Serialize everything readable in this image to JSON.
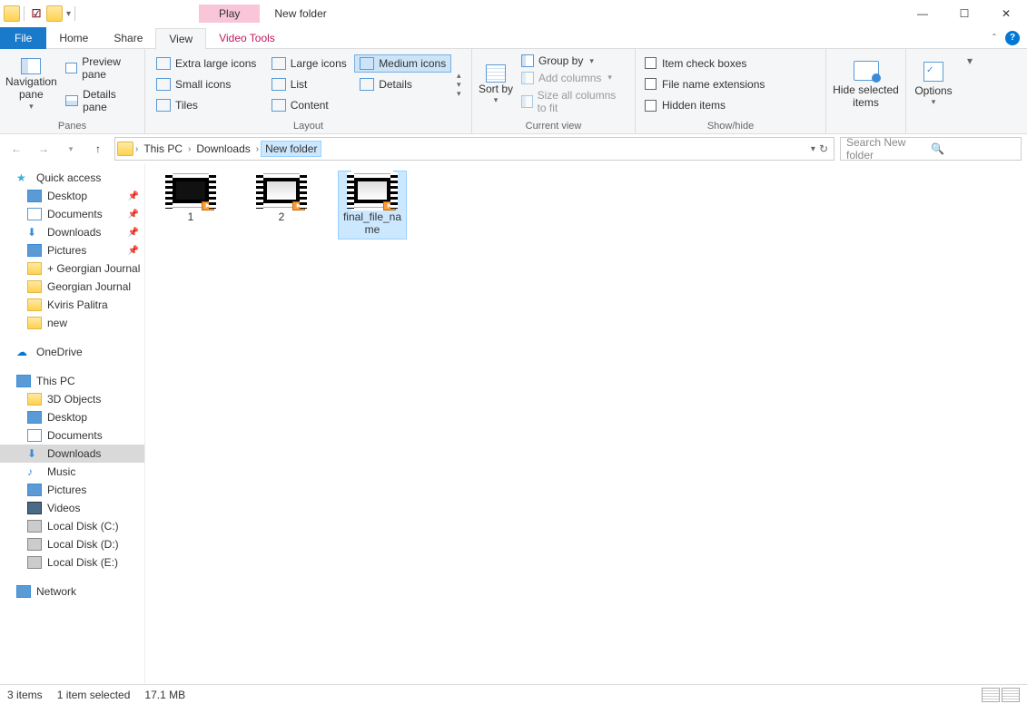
{
  "title": "New folder",
  "play_tab": "Play",
  "menu": {
    "file": "File",
    "home": "Home",
    "share": "Share",
    "view": "View",
    "video": "Video Tools"
  },
  "ribbon": {
    "panes": {
      "nav": "Navigation pane",
      "preview": "Preview pane",
      "details": "Details pane",
      "label": "Panes"
    },
    "layout": {
      "xl": "Extra large icons",
      "lg": "Large icons",
      "med": "Medium icons",
      "sm": "Small icons",
      "list": "List",
      "details": "Details",
      "tiles": "Tiles",
      "content": "Content",
      "label": "Layout"
    },
    "cview": {
      "sort": "Sort by",
      "group": "Group by",
      "addcol": "Add columns",
      "sizecol": "Size all columns to fit",
      "label": "Current view"
    },
    "show": {
      "chk": "Item check boxes",
      "ext": "File name extensions",
      "hidden": "Hidden items",
      "hide": "Hide selected items",
      "label": "Show/hide"
    },
    "options": "Options"
  },
  "breadcrumb": {
    "a": "This PC",
    "b": "Downloads",
    "c": "New folder"
  },
  "search_placeholder": "Search New folder",
  "tree": {
    "quick": "Quick access",
    "desktop": "Desktop",
    "documents": "Documents",
    "downloads": "Downloads",
    "pictures": "Pictures",
    "gj1": "+ Georgian Journal",
    "gj2": "Georgian Journal",
    "kv": "Kviris Palitra",
    "new": "new",
    "onedrive": "OneDrive",
    "thispc": "This PC",
    "obj3d": "3D Objects",
    "desktop2": "Desktop",
    "docs2": "Documents",
    "down2": "Downloads",
    "music": "Music",
    "pics2": "Pictures",
    "videos": "Videos",
    "diskc": "Local Disk (C:)",
    "diskd": "Local Disk (D:)",
    "diske": "Local Disk (E:)",
    "network": "Network"
  },
  "files": {
    "f1": "1",
    "f2": "2",
    "f3": "final_file_name"
  },
  "status": {
    "items": "3 items",
    "sel": "1 item selected",
    "size": "17.1 MB"
  }
}
